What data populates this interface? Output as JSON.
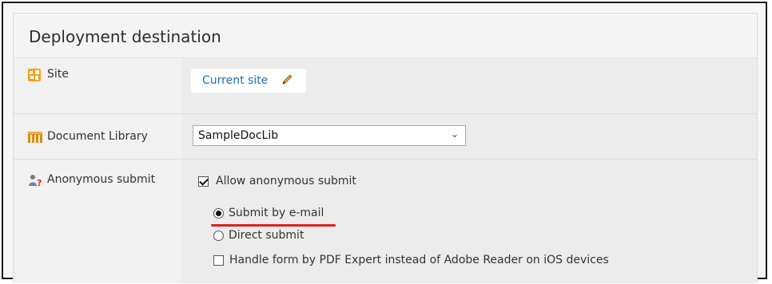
{
  "panel": {
    "title": "Deployment destination"
  },
  "rows": {
    "site": {
      "label": "Site",
      "icon": "site-icon",
      "link_text": "Current site",
      "edit_icon": "pencil-icon"
    },
    "library": {
      "label": "Document Library",
      "icon": "library-icon",
      "selected_value": "SampleDocLib"
    },
    "anonymous": {
      "label": "Anonymous submit",
      "icon": "anonymous-user-icon",
      "allow_label": "Allow anonymous submit",
      "allow_checked": true,
      "submit_email_label": "Submit by e-mail",
      "submit_email_selected": true,
      "direct_submit_label": "Direct submit",
      "direct_submit_selected": false,
      "pdf_expert_label": "Handle form by PDF Expert instead of Adobe Reader on iOS devices",
      "pdf_expert_checked": false
    }
  },
  "colors": {
    "link": "#1d6fb8",
    "highlight_underline": "#e0201f"
  }
}
